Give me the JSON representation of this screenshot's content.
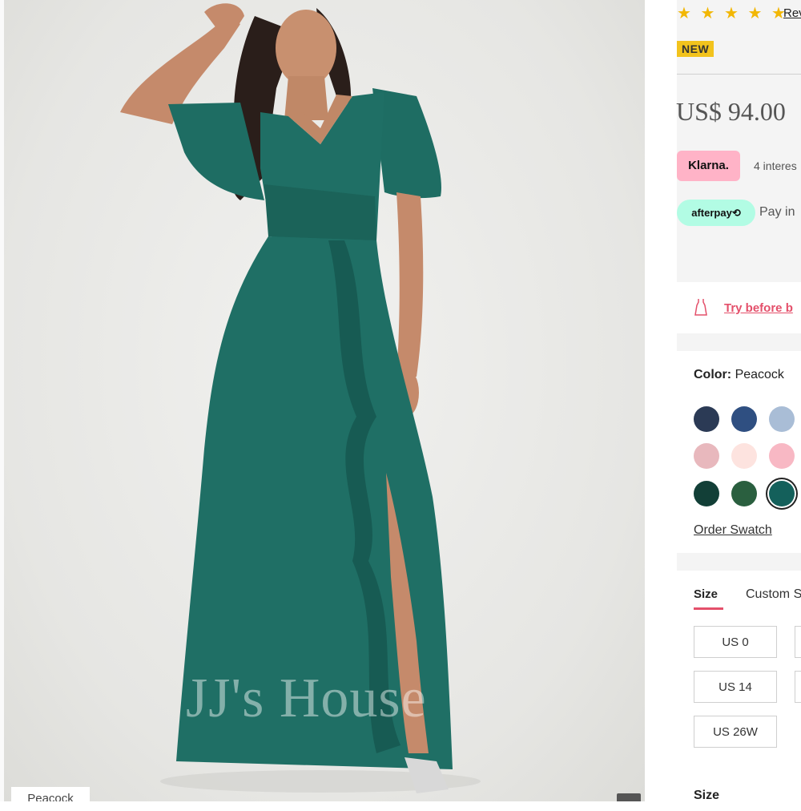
{
  "image": {
    "watermark": "JJ's House",
    "color_tag": "Peacock"
  },
  "rating": {
    "stars": "★ ★ ★ ★ ★",
    "reviews_label": "Rev"
  },
  "badge": "NEW",
  "price": "US$ 94.00",
  "payments": {
    "klarna_label": "Klarna.",
    "klarna_text": "4 interes",
    "afterpay_label": "afterpay⟲",
    "afterpay_text": "Pay in"
  },
  "try_before": {
    "label": "Try before b"
  },
  "color": {
    "label": "Color:",
    "value": "Peacock",
    "swatches": [
      {
        "name": "dark-navy",
        "hex": "#2b3a55"
      },
      {
        "name": "navy",
        "hex": "#2f4f81"
      },
      {
        "name": "dusty-blue",
        "hex": "#a9bdd6"
      },
      {
        "name": "blush",
        "hex": "#e8b8bd"
      },
      {
        "name": "pearl-pink",
        "hex": "#fde3df"
      },
      {
        "name": "candy-pink",
        "hex": "#f8b8c4"
      },
      {
        "name": "dark-green",
        "hex": "#123f37"
      },
      {
        "name": "green",
        "hex": "#2a5f3f"
      },
      {
        "name": "peacock",
        "hex": "#14605b",
        "selected": true
      }
    ],
    "order_swatch": "Order Swatch"
  },
  "size": {
    "tabs": [
      "Size",
      "Custom S"
    ],
    "options": [
      "US 0",
      "US 14",
      "US 26W"
    ],
    "bottom_label": "Size"
  },
  "colors": {
    "accent": "#e4506b",
    "dress": "#1f6f65",
    "star": "#f2b705"
  }
}
